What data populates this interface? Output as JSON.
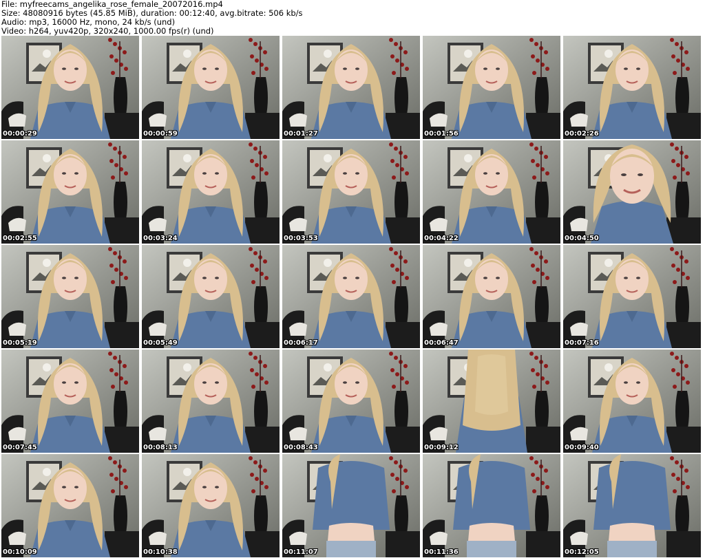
{
  "header": {
    "file_line": "File: myfreecams_angelika_rose_female_20072016.mp4",
    "size_line": "Size: 48080916 bytes (45.85 MiB), duration: 00:12:40, avg.bitrate: 506 kb/s",
    "audio_line": "Audio: mp3, 16000 Hz, mono, 24 kb/s (und)",
    "video_line": "Video: h264, yuv420p, 320x240, 1000.00 fps(r) (und)"
  },
  "colors": {
    "wall": "#a3a69c",
    "frame": "#3a3a3a",
    "poster": "#d8d4c8",
    "hair": "#d8be8e",
    "skin": "#f0d3c2",
    "shirt": "#5b79a3",
    "sofa": "#1c1c1c",
    "vase": "#151515",
    "flower": "#8c1a1a"
  },
  "thumbnails": [
    {
      "time": "00:00:29",
      "variant": "portrait"
    },
    {
      "time": "00:00:59",
      "variant": "portrait"
    },
    {
      "time": "00:01:27",
      "variant": "portrait"
    },
    {
      "time": "00:01:56",
      "variant": "portrait"
    },
    {
      "time": "00:02:26",
      "variant": "portrait"
    },
    {
      "time": "00:02:55",
      "variant": "portrait"
    },
    {
      "time": "00:03:24",
      "variant": "portrait"
    },
    {
      "time": "00:03:53",
      "variant": "portrait"
    },
    {
      "time": "00:04:22",
      "variant": "portrait"
    },
    {
      "time": "00:04:50",
      "variant": "closeup"
    },
    {
      "time": "00:05:19",
      "variant": "portrait"
    },
    {
      "time": "00:05:49",
      "variant": "portrait"
    },
    {
      "time": "00:06:17",
      "variant": "portrait"
    },
    {
      "time": "00:06:47",
      "variant": "portrait"
    },
    {
      "time": "00:07:16",
      "variant": "portrait"
    },
    {
      "time": "00:07:45",
      "variant": "portrait"
    },
    {
      "time": "00:08:13",
      "variant": "portrait"
    },
    {
      "time": "00:08:43",
      "variant": "portrait"
    },
    {
      "time": "00:09:12",
      "variant": "back"
    },
    {
      "time": "00:09:40",
      "variant": "portrait"
    },
    {
      "time": "00:10:09",
      "variant": "portrait"
    },
    {
      "time": "00:10:38",
      "variant": "portrait"
    },
    {
      "time": "00:11:07",
      "variant": "torso"
    },
    {
      "time": "00:11:36",
      "variant": "torso"
    },
    {
      "time": "00:12:05",
      "variant": "torso"
    }
  ]
}
